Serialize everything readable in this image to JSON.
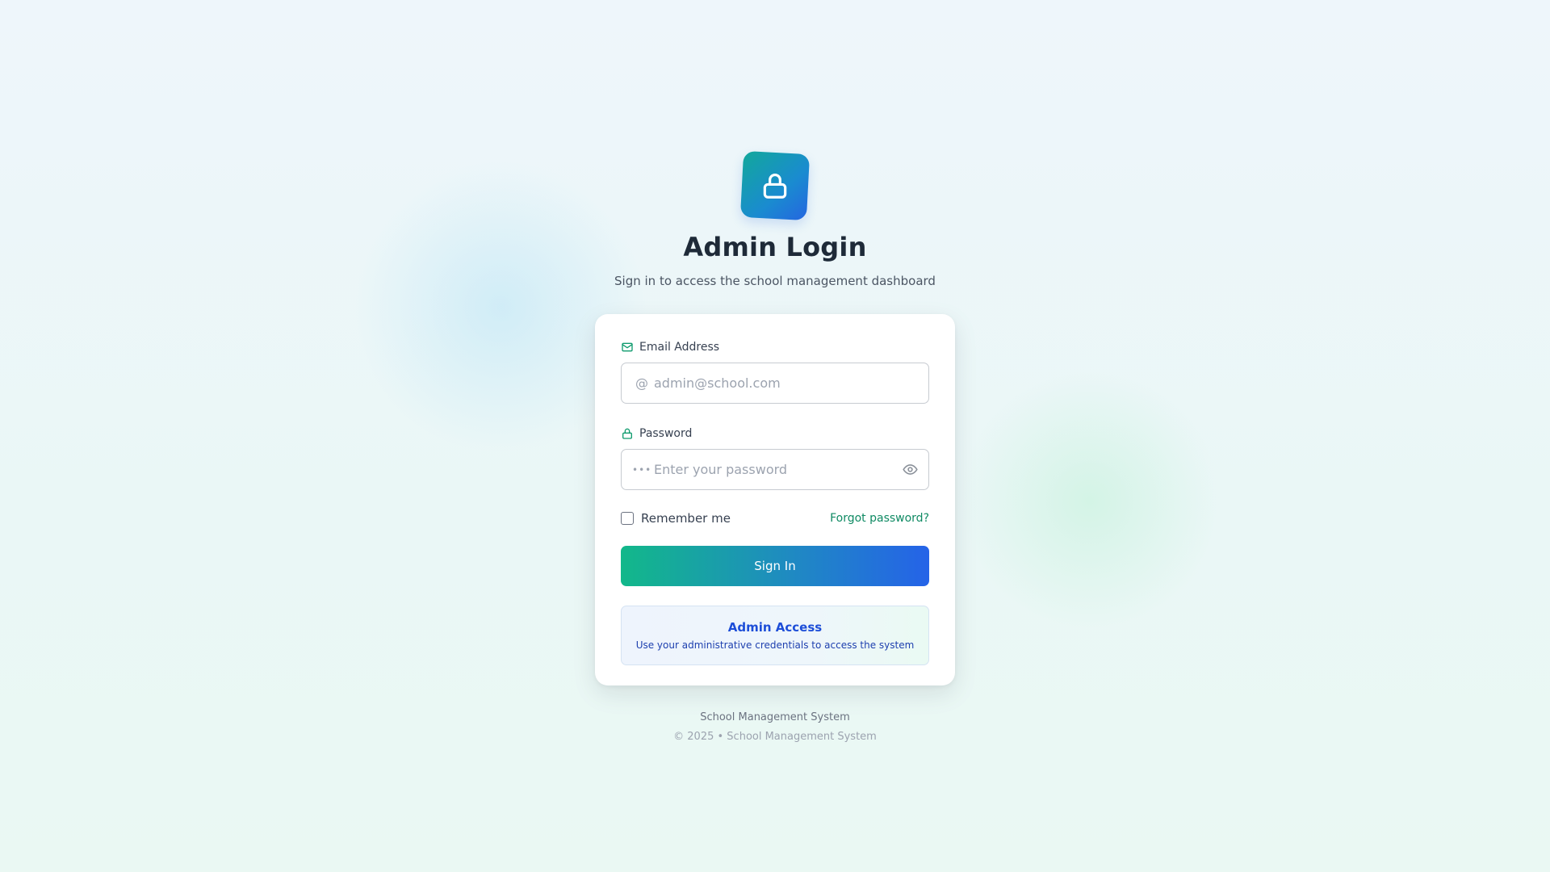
{
  "header": {
    "logo_icon": "lock-icon",
    "title": "Admin Login",
    "subtitle": "Sign in to access the school management dashboard"
  },
  "form": {
    "email": {
      "label": "Email Address",
      "icon": "mail-icon",
      "prefix": "@",
      "placeholder": "admin@school.com",
      "value": ""
    },
    "password": {
      "label": "Password",
      "icon": "lock-icon",
      "prefix": "•••",
      "placeholder": "Enter your password",
      "value": "",
      "toggle_icon": "eye-icon"
    },
    "remember_label": "Remember me",
    "remember_checked": false,
    "forgot_label": "Forgot password?",
    "submit_label": "Sign In"
  },
  "info": {
    "title": "Admin Access",
    "text": "Use your administrative credentials to access the system"
  },
  "footer": {
    "name": "School Management System",
    "copyright": "© 2025 • School Management System"
  },
  "colors": {
    "accent_green": "#0f8a63",
    "accent_blue": "#2563e8",
    "title": "#1e2a38"
  }
}
